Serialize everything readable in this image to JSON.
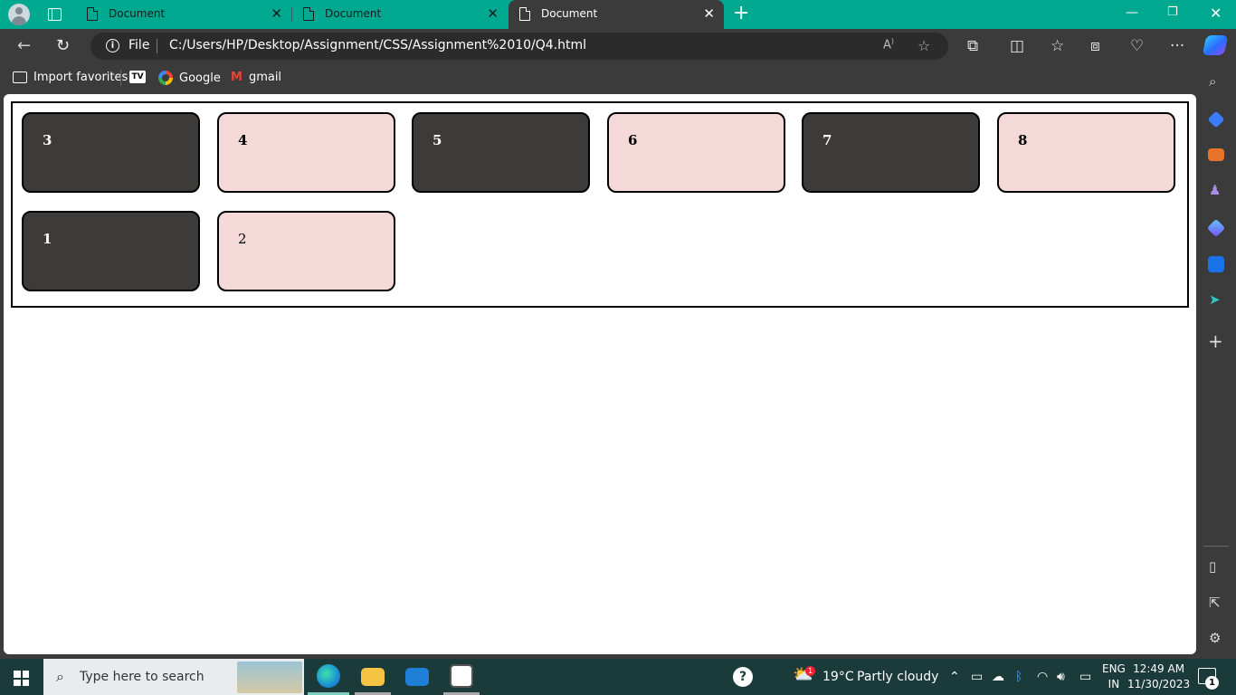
{
  "browser": {
    "tabs": [
      {
        "title": "Document",
        "active": false
      },
      {
        "title": "Document",
        "active": false
      },
      {
        "title": "Document",
        "active": true
      }
    ],
    "address": {
      "scheme_label": "File",
      "url": "C:/Users/HP/Desktop/Assignment/CSS/Assignment%2010/Q4.html"
    },
    "favorites": [
      {
        "label": "Import favorites",
        "icon": "import-icon"
      },
      {
        "label": "",
        "icon": "tradingview-icon",
        "icon_text": "TV"
      },
      {
        "label": "Google",
        "icon": "google-icon"
      },
      {
        "label": "gmail",
        "icon": "gmail-icon"
      }
    ],
    "colors": {
      "tab_strip": "#00a88f",
      "chrome": "#3b3b3b"
    }
  },
  "page": {
    "boxes": [
      "3",
      "4",
      "5",
      "6",
      "7",
      "8",
      "1",
      "2"
    ],
    "colors": {
      "dark_box": "#3d3b3a",
      "pink_box": "#f5d9d9"
    }
  },
  "taskbar": {
    "search_placeholder": "Type here to search",
    "weather": {
      "temp": "19°C",
      "condition": "Partly cloudy",
      "badge": "1"
    },
    "language": {
      "line1": "ENG",
      "line2": "IN"
    },
    "clock": {
      "time": "12:49 AM",
      "date": "11/30/2023"
    },
    "notification_count": "1"
  }
}
